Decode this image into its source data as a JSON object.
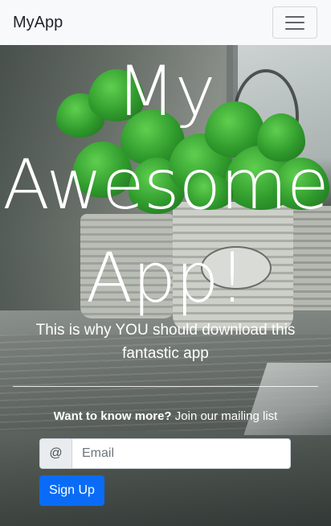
{
  "navbar": {
    "brand": "MyApp",
    "toggler_icon": "hamburger-menu-icon"
  },
  "hero": {
    "title_lines": [
      "My",
      "Awesome",
      "App!"
    ],
    "tagline": "This is why YOU should download this fantastic app"
  },
  "mailing": {
    "prompt_bold": "Want to know more?",
    "prompt_rest": " Join our mailing list",
    "addon": "@",
    "email_placeholder": "Email",
    "email_value": "",
    "signup_label": "Sign Up"
  },
  "colors": {
    "navbar_bg": "#f8f9fa",
    "primary_button": "#0a6cf6",
    "text_on_hero": "#ffffff"
  }
}
